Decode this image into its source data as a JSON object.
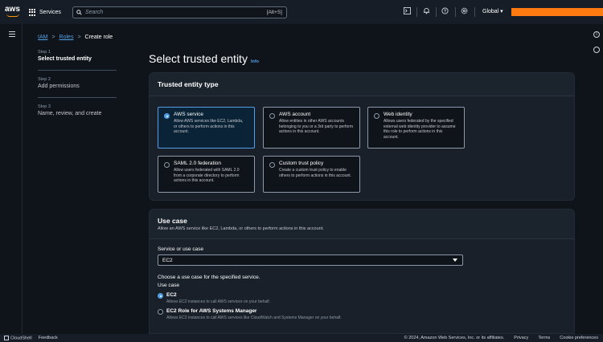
{
  "topnav": {
    "logo_text": "aws",
    "services_label": "Services",
    "search_placeholder": "Search",
    "search_shortcut": "[Alt+S]",
    "region_label": "Global ▾",
    "account_color": "#ff7a10"
  },
  "breadcrumb": {
    "iam": "IAM",
    "roles": "Roles",
    "current": "Create role"
  },
  "steps": [
    {
      "num": "Step 1",
      "label": "Select trusted entity"
    },
    {
      "num": "Step 2",
      "label": "Add permissions"
    },
    {
      "num": "Step 3",
      "label": "Name, review, and create"
    }
  ],
  "page": {
    "title": "Select trusted entity",
    "info": "Info"
  },
  "trusted_entity": {
    "header": "Trusted entity type",
    "tiles": [
      {
        "title": "AWS service",
        "desc": "Allow AWS services like EC2, Lambda, or others to perform actions in this account.",
        "selected": true
      },
      {
        "title": "AWS account",
        "desc": "Allow entities in other AWS accounts belonging to you or a 3rd party to perform actions in this account.",
        "selected": false
      },
      {
        "title": "Web identity",
        "desc": "Allows users federated by the specified external web identity provider to assume this role to perform actions in this account.",
        "selected": false
      },
      {
        "title": "SAML 2.0 federation",
        "desc": "Allow users federated with SAML 2.0 from a corporate directory to perform actions in this account.",
        "selected": false
      },
      {
        "title": "Custom trust policy",
        "desc": "Create a custom trust policy to enable others to perform actions in this account.",
        "selected": false
      }
    ]
  },
  "use_case": {
    "header": "Use case",
    "subheader": "Allow an AWS service like EC2, Lambda, or others to perform actions in this account.",
    "service_label": "Service or use case",
    "service_value": "EC2",
    "choose_text": "Choose a use case for the specified service.",
    "use_case_label": "Use case",
    "options": [
      {
        "title": "EC2",
        "desc": "Allows EC2 instances to call AWS services on your behalf.",
        "selected": true
      },
      {
        "title": "EC2 Role for AWS Systems Manager",
        "desc": "Allows EC2 instances to call AWS services like CloudWatch and Systems Manager on your behalf.",
        "selected": false
      }
    ]
  },
  "footer": {
    "cloudshell": "CloudShell",
    "feedback": "Feedback",
    "copyright": "© 2024, Amazon Web Services, Inc. or its affiliates.",
    "privacy": "Privacy",
    "terms": "Terms",
    "cookies": "Cookie preferences"
  }
}
